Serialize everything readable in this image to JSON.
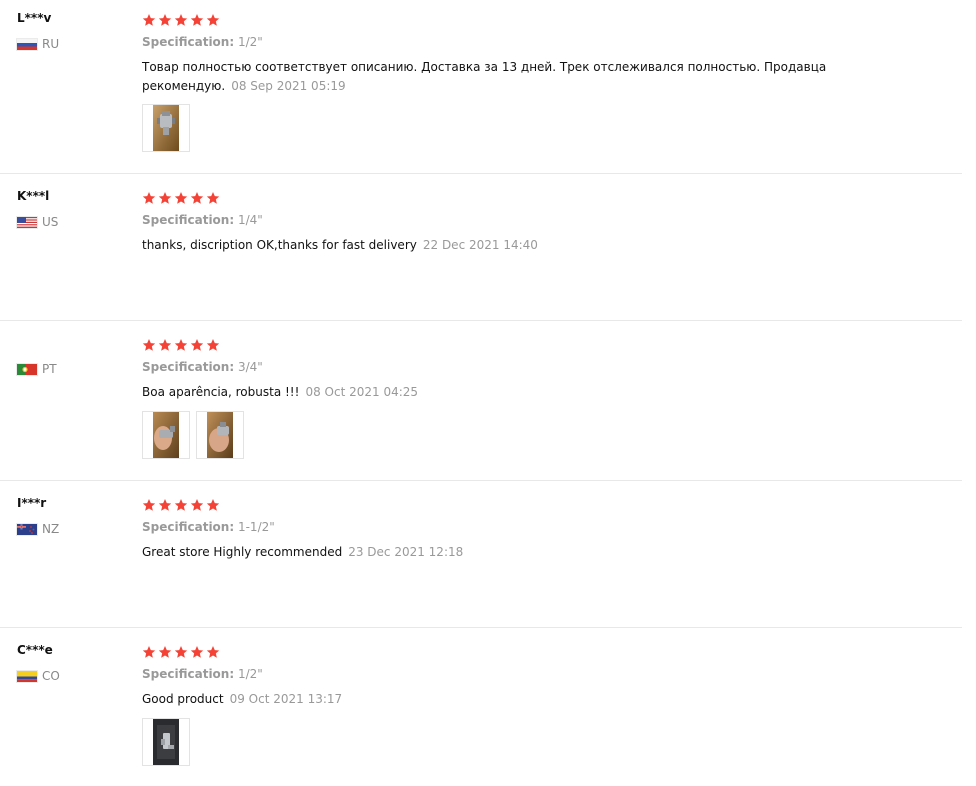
{
  "colors": {
    "star": "#f44336",
    "meta_text": "#999999",
    "divider": "#e8e8e8"
  },
  "spec_label": "Specification:",
  "reviews": [
    {
      "user": "L***v",
      "country": "RU",
      "flag": "flag-ru-icon",
      "stars": 5,
      "specification": "1/2\"",
      "text": "Товар полностью соответствует описанию. Доставка за 13 дней. Трек отслеживался полностью. Продавца рекомендую.",
      "date": "08 Sep 2021 05:19",
      "photos": [
        "review-photo-1"
      ]
    },
    {
      "user": "K***l",
      "country": "US",
      "flag": "flag-us-icon",
      "stars": 5,
      "specification": "1/4\"",
      "text": "thanks, discription OK,thanks for fast delivery",
      "date": "22 Dec 2021 14:40",
      "photos": []
    },
    {
      "user": "",
      "country": "PT",
      "flag": "flag-pt-icon",
      "stars": 5,
      "specification": "3/4\"",
      "text": "Boa aparência, robusta !!!",
      "date": "08 Oct 2021 04:25",
      "photos": [
        "review-photo-1",
        "review-photo-2"
      ]
    },
    {
      "user": "I***r",
      "country": "NZ",
      "flag": "flag-nz-icon",
      "stars": 5,
      "specification": "1-1/2\"",
      "text": "Great store Highly recommended",
      "date": "23 Dec 2021 12:18",
      "photos": []
    },
    {
      "user": "C***e",
      "country": "CO",
      "flag": "flag-co-icon",
      "stars": 5,
      "specification": "1/2\"",
      "text": "Good product",
      "date": "09 Oct 2021 13:17",
      "photos": [
        "review-photo-1"
      ]
    }
  ]
}
